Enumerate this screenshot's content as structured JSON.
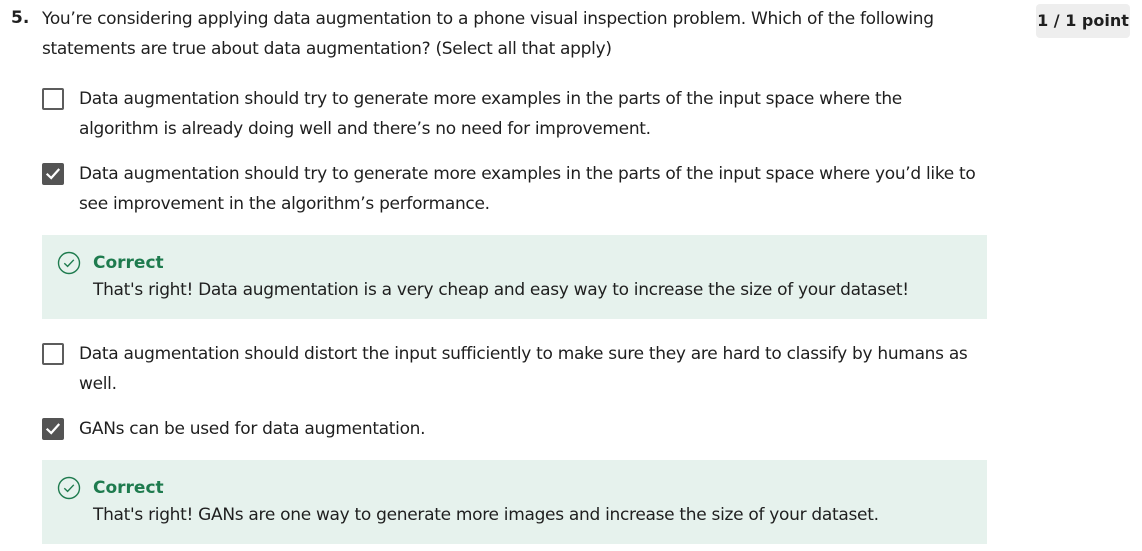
{
  "question": {
    "number": "5.",
    "prompt": "You’re considering applying data augmentation to a phone visual inspection problem. Which of the following statements are true about data augmentation? (Select all that apply)",
    "points": "1 / 1 point"
  },
  "options": [
    {
      "label": "Data augmentation should try to generate more examples in the parts of the input space where the algorithm is already doing well and there’s no need for improvement.",
      "checked": false
    },
    {
      "label": "Data augmentation should try to generate more examples in the parts of the input space where you’d like to see improvement in the algorithm’s performance.",
      "checked": true,
      "feedback": {
        "title": "Correct",
        "text": "That's right! Data augmentation is a very cheap and easy way to increase the size of your dataset!"
      }
    },
    {
      "label": "Data augmentation should distort the input sufficiently to make sure they are hard to classify by humans as well.",
      "checked": false
    },
    {
      "label": "GANs can be used for data augmentation.",
      "checked": true,
      "feedback": {
        "title": "Correct",
        "text": "That's right! GANs are one way to generate more images and increase the size of your dataset."
      }
    }
  ],
  "icons": {
    "checked": "checkmark-icon",
    "feedback": "check-circle-icon"
  },
  "colors": {
    "correct_text": "#1e7b4e",
    "feedback_bg": "#e6f2ed",
    "checkbox_checked": "#545454",
    "points_bg": "#eeeeee"
  }
}
